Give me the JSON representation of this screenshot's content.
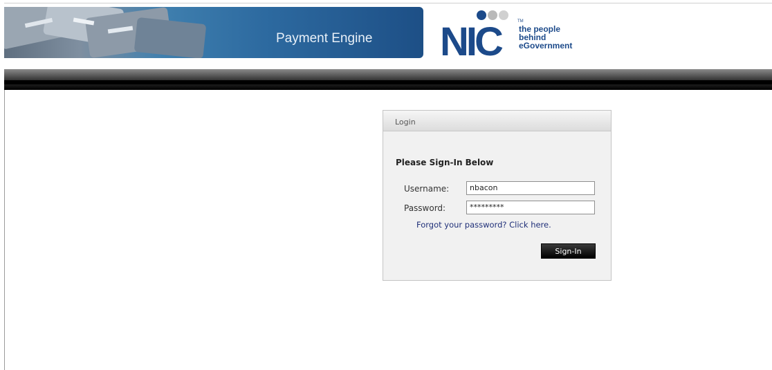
{
  "banner": {
    "title": "Payment Engine"
  },
  "logo": {
    "mark": "NIC",
    "tagline": [
      "the people",
      "behind",
      "eGovernment"
    ],
    "tm": "TM"
  },
  "login": {
    "header": "Login",
    "subtitle": "Please Sign-In Below",
    "username_label": "Username:",
    "username_value": "nbacon",
    "password_label": "Password:",
    "password_value": "*********",
    "forgot_link": "Forgot your password? Click here.",
    "signin_label": "Sign-In"
  },
  "colors": {
    "brand_blue": "#1c4a8a",
    "link": "#1f2f78",
    "button": "#000000"
  }
}
